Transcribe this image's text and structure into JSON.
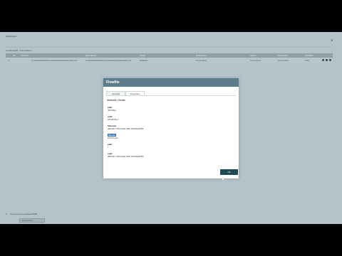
{
  "background": {
    "breadcrumb": "Dashboard",
    "subtitle": "Localhost 80 - Connections",
    "close_glyph": "×",
    "table": {
      "headers": [
        "ID",
        "Source",
        "Description",
        "Target",
        "Description",
        "Status",
        "Description",
        "Modified"
      ],
      "row": [
        "1",
        "C:\\Users\\Public\\Documents\\Samples\\Config.xml",
        "C:\\Users\\Public\\Documents\\Samples\\Config.xml",
        "Enabled",
        "Connected",
        "Connected",
        "Connected",
        "1/12"
      ]
    },
    "footer_text": "Connected to localhost:8080",
    "footer_tab_label": "Connections"
  },
  "modal": {
    "title": "Flowfile",
    "tabs": [
      "General",
      "Properties"
    ],
    "section_title": "Attributes / Details",
    "fields": [
      {
        "label": "path",
        "value": "/Flowfile/"
      },
      {
        "label": "uuid",
        "value": "f27a9c4b-0"
      },
      {
        "label": "filename",
        "value": "a8f4d27-7f34-4e8e-9f3f-7b0c5da1f8f2"
      },
      {
        "label": "filesize",
        "value": "1024 bytes"
      },
      {
        "label": "path",
        "value": "/"
      },
      {
        "label": "uuid",
        "value": "a8f4d27-7f34-4e8e-9f3f-7b0c5da1f8f2"
      }
    ],
    "ok_label": "OK"
  },
  "colors": {
    "overlay": "#b3c3c8",
    "header": "#5f7c8a",
    "button": "#1f4b55",
    "selection": "#2f6fb0"
  }
}
